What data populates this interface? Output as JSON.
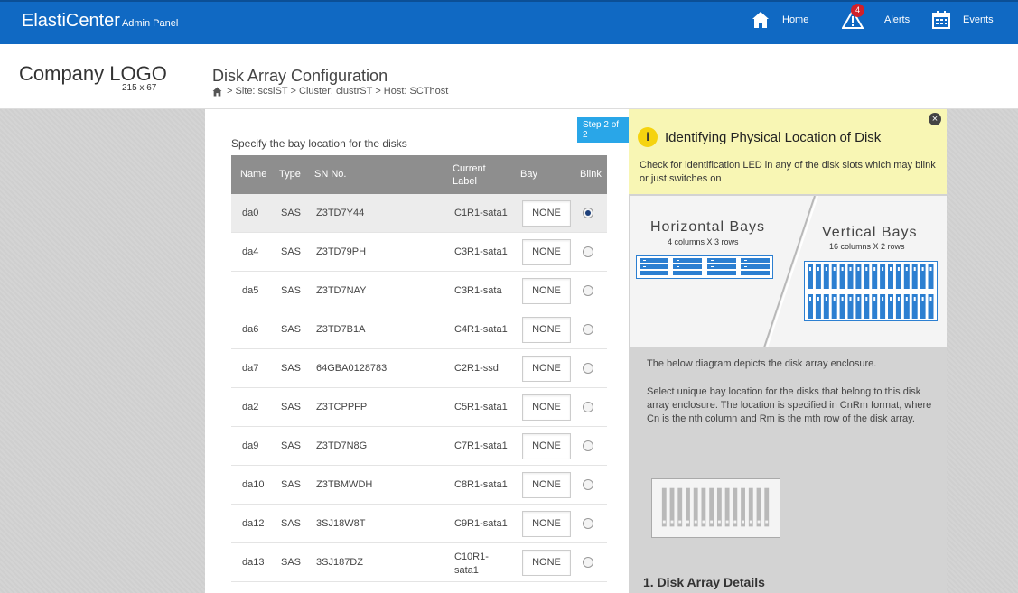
{
  "topbar": {
    "brand": "ElastiCenter",
    "brand_sub": "Admin Panel",
    "nav": {
      "home": "Home",
      "alerts": "Alerts",
      "alerts_count": "4",
      "events": "Events"
    },
    "color": "#1069c3"
  },
  "header": {
    "logo": "Company LOGO",
    "logo_size": "215 x 67",
    "title": "Disk Array Configuration",
    "breadcrumb": {
      "site": "> Site: scsiST",
      "cluster": "> Cluster: clustrST",
      "host": "> Host: SCThost"
    }
  },
  "main": {
    "step": "Step 2 of 2",
    "instruction": "Specify the bay location for the disks",
    "columns": {
      "name": "Name",
      "type": "Type",
      "sn": "SN No.",
      "current_label_1": "Current",
      "current_label_2": "Label",
      "bay": "Bay",
      "blink": "Blink"
    },
    "rows": [
      {
        "name": "da0",
        "type": "SAS",
        "sn": "Z3TD7Y44",
        "label": "C1R1-sata1",
        "label2": "",
        "bay": "NONE",
        "blink": true
      },
      {
        "name": "da4",
        "type": "SAS",
        "sn": "Z3TD79PH",
        "label": "C3R1-sata1",
        "label2": "",
        "bay": "NONE",
        "blink": false
      },
      {
        "name": "da5",
        "type": "SAS",
        "sn": "Z3TD7NAY",
        "label": "C3R1-sata",
        "label2": "",
        "bay": "NONE",
        "blink": false
      },
      {
        "name": "da6",
        "type": "SAS",
        "sn": "Z3TD7B1A",
        "label": "C4R1-sata1",
        "label2": "",
        "bay": "NONE",
        "blink": false
      },
      {
        "name": "da7",
        "type": "SAS",
        "sn": "64GBA0128783",
        "label": "C2R1-ssd",
        "label2": "",
        "bay": "NONE",
        "blink": false
      },
      {
        "name": "da2",
        "type": "SAS",
        "sn": "Z3TCPPFP",
        "label": "C5R1-sata1",
        "label2": "",
        "bay": "NONE",
        "blink": false
      },
      {
        "name": "da9",
        "type": "SAS",
        "sn": "Z3TD7N8G",
        "label": "C7R1-sata1",
        "label2": "",
        "bay": "NONE",
        "blink": false
      },
      {
        "name": "da10",
        "type": "SAS",
        "sn": "Z3TBMWDH",
        "label": "C8R1-sata1",
        "label2": "",
        "bay": "NONE",
        "blink": false
      },
      {
        "name": "da12",
        "type": "SAS",
        "sn": "3SJ18W8T",
        "label": "C9R1-sata1",
        "label2": "",
        "bay": "NONE",
        "blink": false
      },
      {
        "name": "da13",
        "type": "SAS",
        "sn": "3SJ187DZ",
        "label": "C10R1-",
        "label2": "sata1",
        "bay": "NONE",
        "blink": false
      }
    ]
  },
  "side": {
    "info_title": "Identifying Physical Location of Disk",
    "info_text": "Check for identification LED in any of the disk slots which may blink or just switches on",
    "horizontal_title": "Horizontal Bays",
    "horizontal_sub": "4 columns X 3 rows",
    "vertical_title": "Vertical Bays",
    "vertical_sub": "16 columns X 2 rows",
    "desc1": "The below diagram depicts the disk array enclosure.",
    "desc2": "Select unique bay location for the disks that belong to this disk array enclosure. The location is specified in CnRm format, where Cn is the nth column and Rm is the mth row of the disk array.",
    "details_title": "1. Disk Array Details"
  }
}
